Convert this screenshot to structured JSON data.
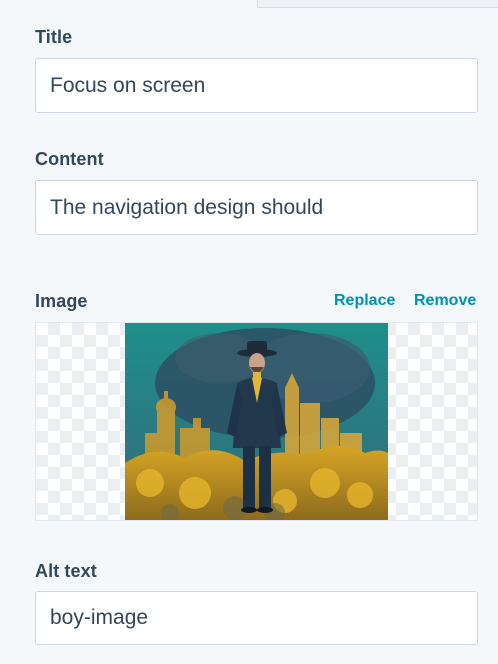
{
  "fields": {
    "title": {
      "label": "Title",
      "value": "Focus on screen"
    },
    "content": {
      "label": "Content",
      "value": "The navigation design should"
    },
    "image": {
      "label": "Image",
      "replace_label": "Replace",
      "remove_label": "Remove"
    },
    "alt_text": {
      "label": "Alt text",
      "value": "boy-image"
    }
  },
  "colors": {
    "link": "#0091ae",
    "text": "#33475b",
    "panel_background": "#f5f8fa",
    "input_border": "#cbd6e2"
  }
}
